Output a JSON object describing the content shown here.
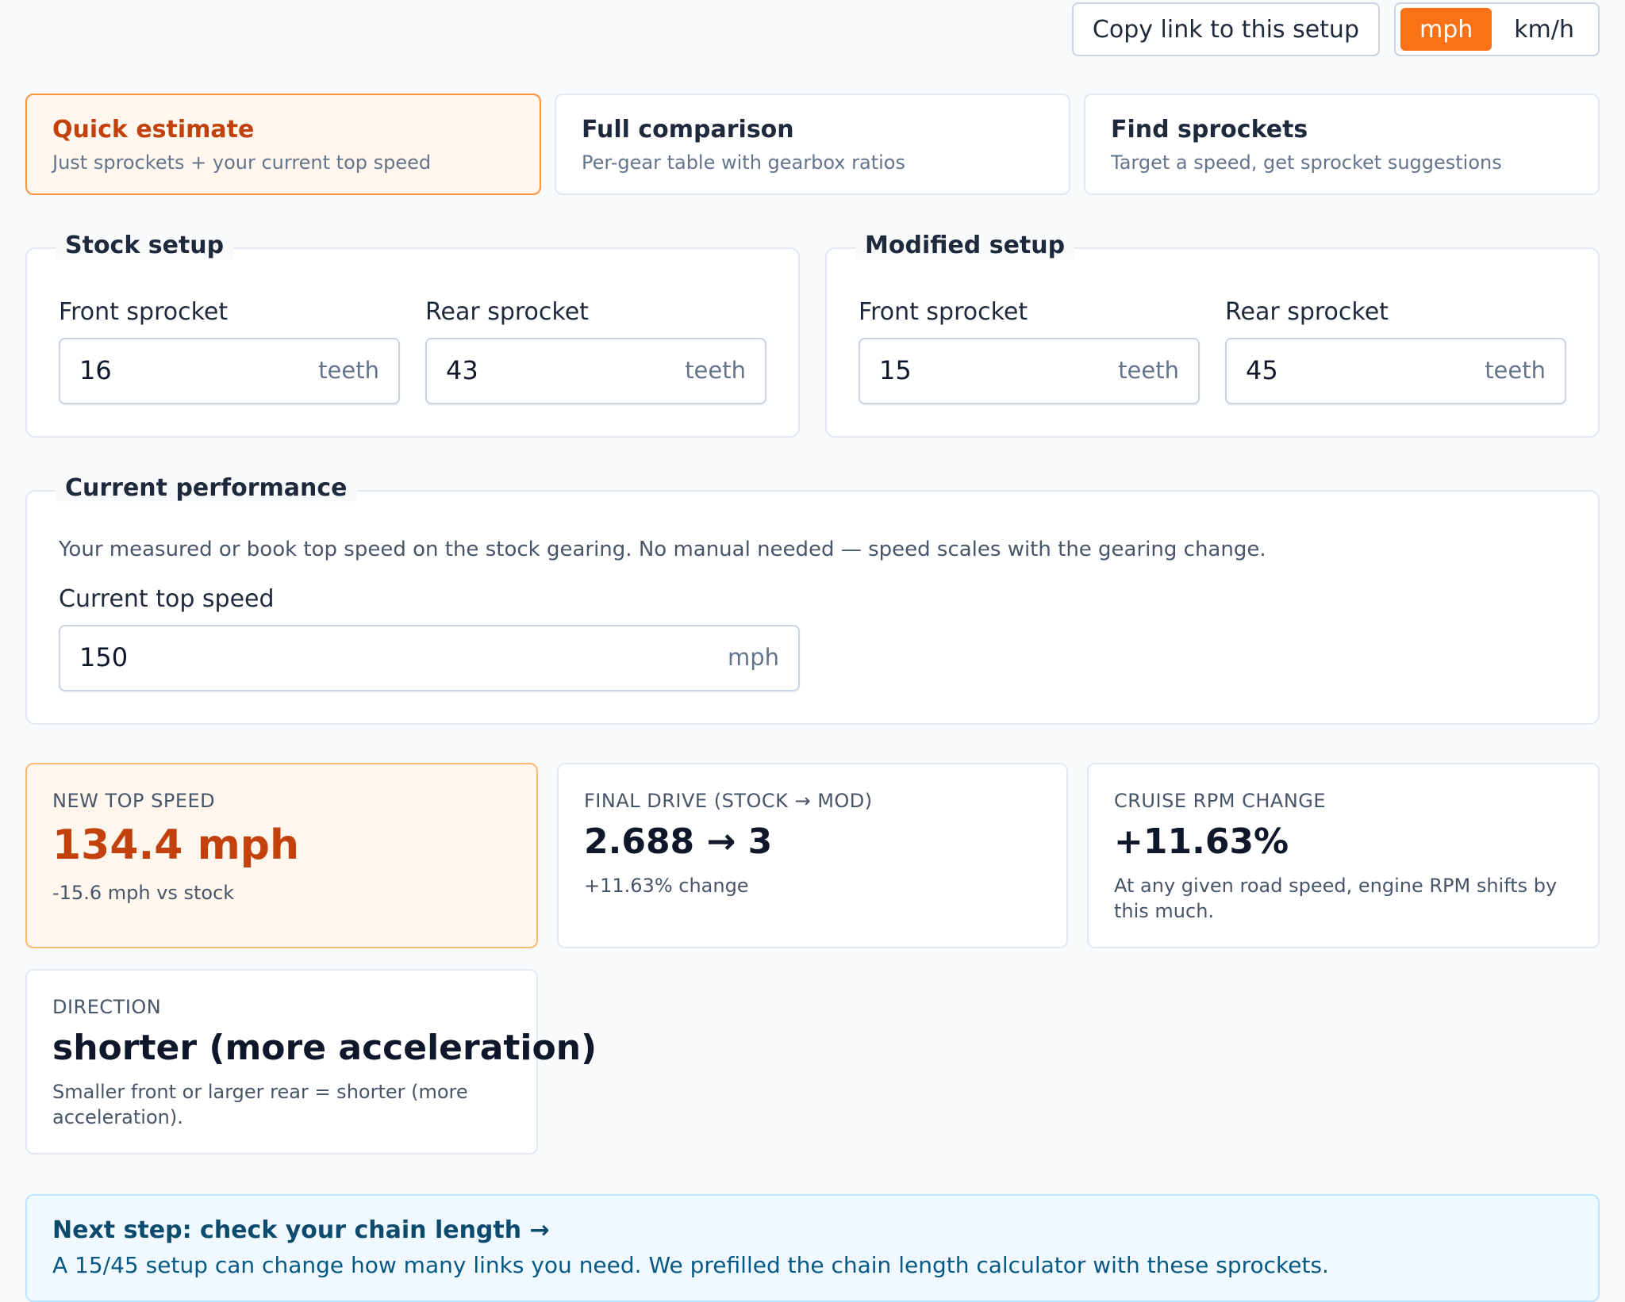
{
  "toolbar": {
    "copy_link_label": "Copy link to this setup",
    "units": [
      {
        "label": "mph",
        "active": true
      },
      {
        "label": "km/h",
        "active": false
      }
    ]
  },
  "modes": [
    {
      "title": "Quick estimate",
      "desc": "Just sprockets + your current top speed",
      "active": true
    },
    {
      "title": "Full comparison",
      "desc": "Per-gear table with gearbox ratios",
      "active": false
    },
    {
      "title": "Find sprockets",
      "desc": "Target a speed, get sprocket suggestions",
      "active": false
    }
  ],
  "stock": {
    "legend": "Stock setup",
    "front_label": "Front sprocket",
    "front_value": "16",
    "rear_label": "Rear sprocket",
    "rear_value": "43",
    "unit": "teeth"
  },
  "modified": {
    "legend": "Modified setup",
    "front_label": "Front sprocket",
    "front_value": "15",
    "rear_label": "Rear sprocket",
    "rear_value": "45",
    "unit": "teeth"
  },
  "performance": {
    "legend": "Current performance",
    "help": "Your measured or book top speed on the stock gearing. No manual needed — speed scales with the gearing change.",
    "speed_label": "Current top speed",
    "speed_value": "150",
    "speed_unit": "mph"
  },
  "results": {
    "new_top_speed": {
      "label": "New top speed",
      "value": "134.4 mph",
      "sub": "-15.6 mph vs stock"
    },
    "final_drive": {
      "label": "Final drive (stock → mod)",
      "value": "2.688 → 3",
      "sub": "+11.63% change"
    },
    "cruise_rpm": {
      "label": "Cruise RPM change",
      "value": "+11.63%",
      "sub": "At any given road speed, engine RPM shifts by this much."
    },
    "direction": {
      "label": "Direction",
      "value": "shorter (more acceleration)",
      "sub": "Smaller front or larger rear = shorter (more acceleration)."
    }
  },
  "callout": {
    "title": "Next step: check your chain length →",
    "text": "A 15/45 setup can change how many links you need. We prefilled the chain length calculator with these sprockets."
  },
  "colors": {
    "accent": "#f97316",
    "accent_dark": "#c2410c",
    "highlight_bg": "#fff7ed",
    "callout_bg": "#f0f9ff"
  }
}
